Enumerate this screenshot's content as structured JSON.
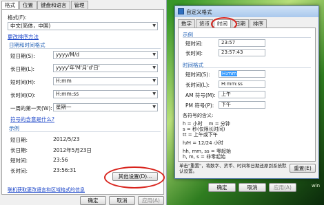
{
  "left_dialog": {
    "tabs": [
      "格式",
      "位置",
      "键盘和语言",
      "管理"
    ],
    "format_label": "格式(F):",
    "format_value": "中文(简体，中国)",
    "sort_link": "更改排序方法",
    "datetime_group": "日期和时间格式",
    "rows": [
      {
        "label": "短日期(S):",
        "value": "yyyy/M/d"
      },
      {
        "label": "长日期(L):",
        "value": "yyyy'年'M'月'd'日'"
      },
      {
        "label": "短时间(H):",
        "value": "H:mm"
      },
      {
        "label": "长时间(O):",
        "value": "H:mm:ss"
      },
      {
        "label": "一周的第一天(W):",
        "value": "星期一"
      }
    ],
    "symbols_link": "符号的含意是什么?",
    "example_group": "示例",
    "examples": [
      {
        "label": "短日期:",
        "value": "2012/5/23"
      },
      {
        "label": "长日期:",
        "value": "2012年5月23日"
      },
      {
        "label": "短时间:",
        "value": "23:56"
      },
      {
        "label": "长时间:",
        "value": "23:56:31"
      }
    ],
    "other_settings_button": "其他设置(D)...",
    "online_link": "联机获取更改语言和区域格式的信息",
    "ok_button": "确定",
    "cancel_button": "取消",
    "apply_button": "应用(A)"
  },
  "right_dialog": {
    "title": "自定义格式",
    "tabs": [
      "数字",
      "货币",
      "时间",
      "日期",
      "排序"
    ],
    "example_group": "示例",
    "examples": [
      {
        "label": "短时间:",
        "value": "23:57"
      },
      {
        "label": "长时间:",
        "value": "23:57:43"
      }
    ],
    "time_format_group": "时间格式",
    "time_rows": [
      {
        "label": "短时间(S):",
        "value": "H:mm"
      },
      {
        "label": "长时间(L):",
        "value": "H:mm:ss"
      },
      {
        "label": "AM 符号(M):",
        "value": "上午"
      },
      {
        "label": "PM 符号(P):",
        "value": "下午"
      }
    ],
    "notes": [
      "各符号的含义:",
      "h = 小时    m = 分钟",
      "s = 秒(仅限长时间)",
      "tt = 上午或下午",
      "h/H = 12/24 小时",
      "hh, mm, ss = 零起始",
      "h, m, s = 非零起始"
    ],
    "reset_text": "单击\"重置\"，将数字、货币、时间和日期还原到系统默认设置。",
    "reset_button": "重置(E)",
    "ok_button": "确定",
    "cancel_button": "取消",
    "apply_button": "应用(A)"
  },
  "desktop_text": "win",
  "colors": {
    "link": "#1a44c8",
    "group_heading": "#1f5fb5",
    "highlight": "#d8231c",
    "selection": "#3399ff"
  }
}
